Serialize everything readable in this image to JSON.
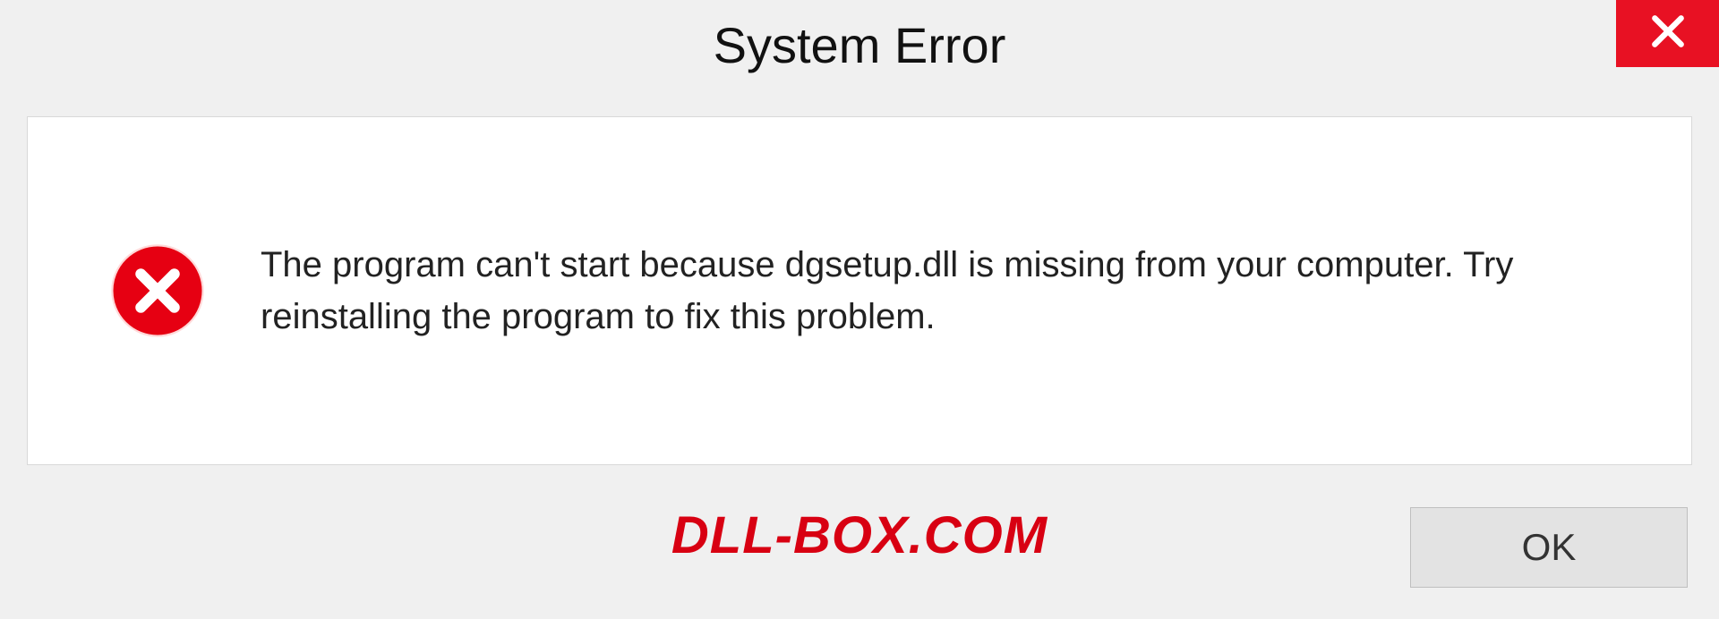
{
  "dialog": {
    "title": "System Error",
    "message": "The program can't start because dgsetup.dll is missing from your computer. Try reinstalling the program to fix this problem.",
    "ok_label": "OK"
  },
  "watermark": "DLL-BOX.COM",
  "colors": {
    "close_bg": "#e81123",
    "error_icon": "#e60012",
    "watermark": "#d80012"
  }
}
